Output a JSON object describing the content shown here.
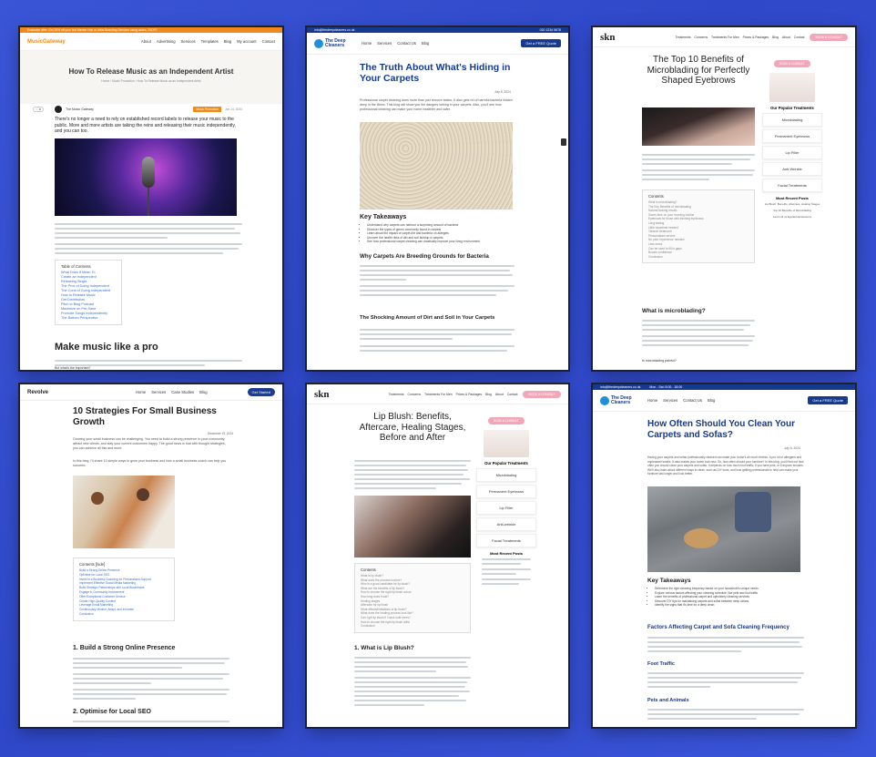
{
  "cards": {
    "music": {
      "topbar": "Exclusive offer: Get 25% off your first Mentor Hub or Artist Branding Services using codes, 25OFF",
      "logo": "MusicGateway",
      "nav": [
        "About",
        "Advertising",
        "Services",
        "Templates",
        "Blog",
        "My account",
        "Contact"
      ],
      "title": "How To Release Music as an Independent Artist",
      "breadcrumb": "Home › Music Promotion › How To Release Music as an Independent Artist",
      "author": "The Music Gateway",
      "category_tag": "Music Promotion",
      "date": "Jun 14, 2024",
      "lead": "There's no longer a need to rely on established record labels to release your music to the public. More and more artists are taking the reins and releasing their music independently, and you can too.",
      "toc_title": "Table of Contents",
      "toc_items": [
        "What Does It Mean To",
        "Create an Independent",
        "Releasing Single",
        "The Pros of Doing Independent",
        "The Cons of Going Independent",
        "How to Release Music",
        "Get Distribution",
        "Pitch to Blog Podcast",
        "Maximize on Pre-Save",
        "Promote Songs Independently",
        "The Bottom Perspective"
      ],
      "h2": "Make music like a pro",
      "subq": "But what's the important?"
    },
    "carpets": {
      "topbar": "info@thedeepcleaners.co.uk",
      "topbar_phone": "020 1234 5678",
      "logo": "The Deep Cleaners",
      "nav": [
        "Home",
        "Services",
        "Contact Us",
        "Blog"
      ],
      "cta": "Get a FREE Quote",
      "title": "The Truth About What's Hiding in Your Carpets",
      "date": "July 8, 2024",
      "intro": "Professional carpet cleaning does more than just remove stains. It also gets rid of harmful bacteria hidden deep in the fibres. This blog will show you the dangers lurking in your carpets. Also, you'll see how professional cleaning can make your home healthier and safer.",
      "kt_title": "Key Takeaways",
      "kt_items": [
        "Understand why carpets can harbour a surprising amount of bacteria",
        "Discover the types of germs commonly found in carpets",
        "Learn about the impact of carpet dirt and bacteria on allergies",
        "Uncover the health risks of dirt and soil buildup in carpets",
        "See how professional carpet cleaning can drastically improve your living environment"
      ],
      "h2a": "Why Carpets Are Breeding Grounds for Bacteria",
      "h2b": "The Shocking Amount of Dirt and Soil in Your Carpets"
    },
    "skin_eyebrows": {
      "logo": "skn",
      "nav": [
        "Treatments",
        "Concerns",
        "Treatments For Men",
        "Prices & Packages",
        "Blog",
        "About",
        "Contact"
      ],
      "cta": "BOOK A CONSULT",
      "title": "The Top 10 Benefits of Microblading for Perfectly Shaped Eyebrows",
      "side_pill": "BOOK A CONSULT",
      "side_title": "Our Popular Treatments",
      "side_items": [
        "Microblading",
        "Permanent Eyebrows",
        "Lip Filler",
        "Anti-Wrinkle",
        "Facial Treatments"
      ],
      "recent_title": "Most Recent Posts",
      "recent_items": [
        "Lip Blush: Benefits, Aftercare, Healing Stages",
        "Top 10 Benefits of Microblading",
        "Lash Lift vs Eyelash Extensions"
      ],
      "contents_title": "Contents",
      "contents_items": [
        "What is microblading?",
        "The Key Benefits of microblading",
        "Natural looking results",
        "Saves time on your morning routine",
        "Eyebrows for those with thinning eyebrows",
        "Long lasting",
        "Little downtime needed",
        "Tailored treatment",
        "Personalised service",
        "No prior experience needed",
        "Less mess",
        "Can be used to fill in gaps",
        "Boosts confidence",
        "Conclusion"
      ],
      "h2": "What is microblading?",
      "faq": "Is microblading painful?"
    },
    "revolve": {
      "logo": "Revolve",
      "nav": [
        "Home",
        "Services",
        "Case Studies",
        "Blog"
      ],
      "cta": "Get Started",
      "title": "10 Strategies For Small Business Growth",
      "date": "December 19, 2024",
      "intro": "Growing your small business can be challenging. You need to build a strong presence in your community, attract new clients, and stay your current customers happy. The good news is that with thought strategies, you can achieve all this and more.",
      "intro2": "In this blog, I'll share 10 simple ways to grow your business and how a small business coach can help you succeed.",
      "toc_title": "Contents [hide]",
      "toc_items": [
        "Build a Strong Online Presence",
        "Optimise for Local SEO",
        "Invest in a Business Coaching for Personalised Support",
        "Implement Effective Social Media Marketing",
        "Build Strategic Partnerships with Local Businesses",
        "Engage in Community Involvement",
        "Offer Exceptional Customer Service",
        "Create High-Quality Content",
        "Leverage Email Marketing",
        "Continuously Monitor, Adapt, and Innovate",
        "Conclusion"
      ],
      "h2a": "1. Build a Strong Online Presence",
      "h2b": "2. Optimise for Local SEO"
    },
    "skin_lips": {
      "logo": "skn",
      "nav": [
        "Treatments",
        "Concerns",
        "Treatments For Men",
        "Prices & Packages",
        "Blog",
        "About",
        "Contact"
      ],
      "cta": "BOOK A CONSULT",
      "title": "Lip Blush: Benefits, Aftercare, Healing Stages, Before and After",
      "side_pill": "BOOK A CONSULT",
      "side_title": "Our Popular Treatments",
      "side_items": [
        "Microblading",
        "Permanent Eyebrows",
        "Lip Filler",
        "Anti-wrinkle",
        "Facial Treatments"
      ],
      "recent_title": "Most Recent Posts",
      "contents_title": "Contents",
      "contents_items": [
        "What is lip blush?",
        "What does the process involve?",
        "Who is a good candidate for lip blush?",
        "What are the benefits of lip blush?",
        "How to choose the right lip blush colour",
        "How long does it last?",
        "Healing stages",
        "Aftercare for lip blush",
        "What effects/limitations of lip blush?",
        "What does the healing process look like?",
        "Can I get lip blush if I have cold sores?",
        "How to choose the right lip blush artist",
        "Conclusion"
      ],
      "h2": "1. What is Lip Blush?"
    },
    "sofas": {
      "topbar": "info@thedeepcleaners.co.uk",
      "topbar_hours": "Mon - Sat: 8:00 - 18:00",
      "logo": "The Deep Cleaners",
      "nav": [
        "Home",
        "Services",
        "Contact Us",
        "Blog"
      ],
      "cta": "Get a FREE Quote",
      "title": "How Often Should You Clean Your Carpets and Sofas?",
      "date": "July 8, 2024",
      "intro": "Having your carpets and sofas professionally cleaned can make your home's air much fresher. A pro rid of allergens and unpleasant smells. It also makes your home look new. So, how often should your furniture? In this blog, you'll find out how often you should clean your carpets and sofas. It depends on how much foot traffic, if you have pets, or if anyone smokes. We'll also learn about different ways to clean, such as DIY tools, and how getting professionals to help can make your furniture last longer and look better.",
      "kt_title": "Key Takeaways",
      "kt_items": [
        "Determine the right cleaning frequency based on your household's unique needs",
        "Explore various factors affecting your cleaning schedule, like pets and foot traffic",
        "Learn the benefits of professional carpet and upholstery cleaning services",
        "Discover DIY tips for maintaining carpets and sofas between deep cleans",
        "Identify the signs that it's time for a deep clean"
      ],
      "h2a": "Factors Affecting Carpet and Sofa Cleaning Frequency",
      "h3a": "Foot Traffic",
      "h3b": "Pets and Animals"
    }
  },
  "colors": {
    "background": "#3350d3",
    "deep_blue": "#163a8f",
    "teal": "#1e8fd8",
    "pink": "#f2a6b8",
    "orange": "#f08a1c"
  }
}
